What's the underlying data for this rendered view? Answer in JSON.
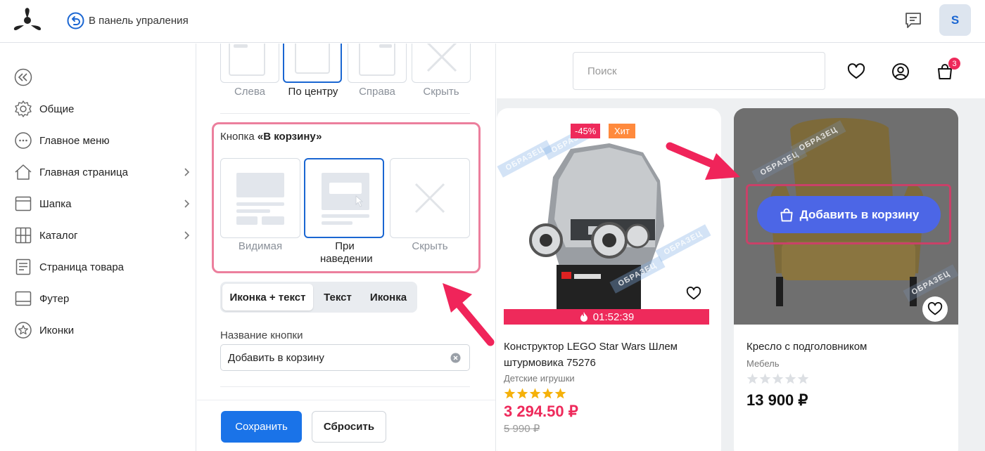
{
  "topbar": {
    "back_label": "В панель упраления",
    "avatar_letter": "S"
  },
  "sidebar": {
    "items": [
      {
        "label": "Общие",
        "icon": "gear-icon",
        "chevron": false
      },
      {
        "label": "Главное меню",
        "icon": "dots-circle-icon",
        "chevron": false
      },
      {
        "label": "Главная страница",
        "icon": "home-icon",
        "chevron": true
      },
      {
        "label": "Шапка",
        "icon": "header-layout-icon",
        "chevron": true
      },
      {
        "label": "Каталог",
        "icon": "grid-icon",
        "chevron": true
      },
      {
        "label": "Страница товара",
        "icon": "document-icon",
        "chevron": false
      },
      {
        "label": "Футер",
        "icon": "footer-layout-icon",
        "chevron": false
      },
      {
        "label": "Иконки",
        "icon": "star-circle-icon",
        "chevron": false
      }
    ]
  },
  "panel": {
    "align_options": [
      "Слева",
      "По центру",
      "Справа",
      "Скрыть"
    ],
    "align_selected": "По центру",
    "button_section_prefix": "Кнопка ",
    "button_section_name": "«В корзину»",
    "visibility_options": [
      "Видимая",
      "При наведении",
      "Скрыть"
    ],
    "visibility_selected": "При наведении",
    "style_options": [
      "Иконка + текст",
      "Текст",
      "Иконка"
    ],
    "style_selected": "Иконка + текст",
    "name_label": "Название кнопки",
    "name_value": "Добавить в корзину",
    "save_label": "Сохранить",
    "reset_label": "Сбросить"
  },
  "preview": {
    "search_placeholder": "Поиск",
    "cart_count": "3",
    "watermark": "ОБРАЗЕЦ",
    "products": [
      {
        "name": "Конструктор LEGO Star Wars Шлем штурмовика 75276",
        "category": "Детские игрушки",
        "discount_badge": "-45%",
        "hit_badge": "Хит",
        "timer": "01:52:39",
        "price": "3 294.50 ₽",
        "old_price": "5 990 ₽",
        "rating": 5
      },
      {
        "name": "Кресло с подголовником",
        "category": "Мебель",
        "price": "13 900 ₽",
        "rating": 0,
        "add_to_cart": "Добавить в корзину"
      }
    ]
  },
  "colors": {
    "accent": "#1a73e8",
    "highlight": "#ec7f9d",
    "sale": "#ee2a5b",
    "cart_button": "#4c66e6",
    "annotation_arrow": "#f0245a"
  }
}
